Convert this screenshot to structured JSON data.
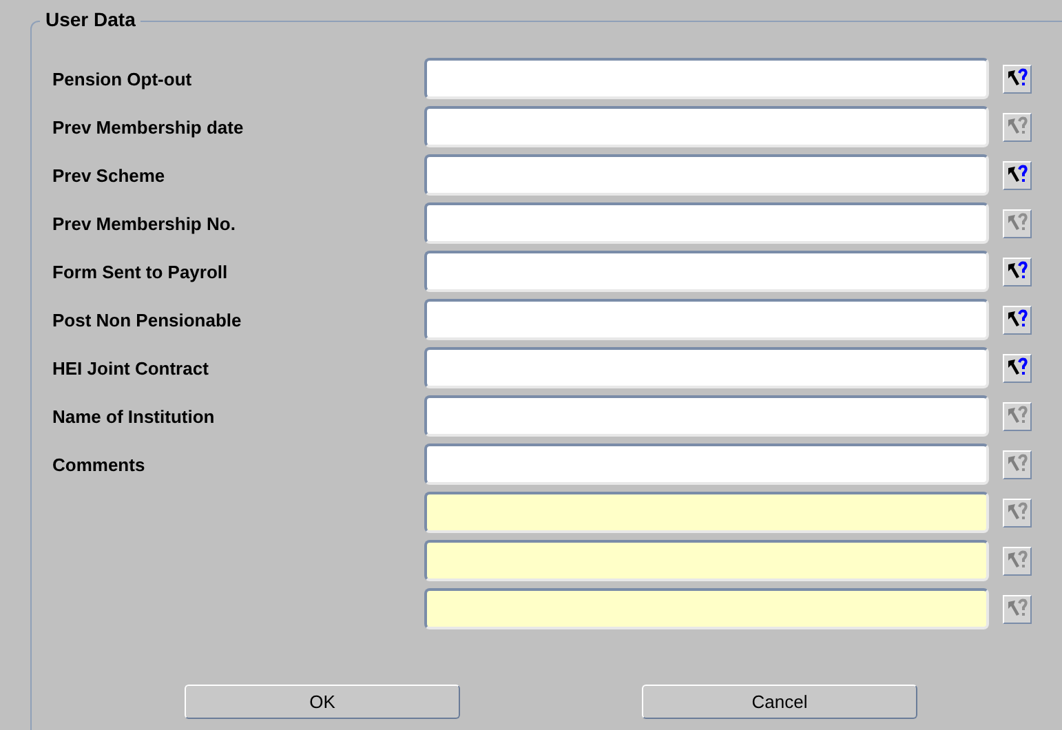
{
  "frame": {
    "title": "User Data"
  },
  "fields": [
    {
      "label": "Pension Opt-out",
      "highlighted": false,
      "lov_disabled": false
    },
    {
      "label": "Prev Membership date",
      "highlighted": false,
      "lov_disabled": true
    },
    {
      "label": "Prev Scheme",
      "highlighted": false,
      "lov_disabled": false
    },
    {
      "label": "Prev Membership No.",
      "highlighted": false,
      "lov_disabled": true
    },
    {
      "label": "Form Sent to Payroll",
      "highlighted": false,
      "lov_disabled": false
    },
    {
      "label": "Post Non Pensionable",
      "highlighted": false,
      "lov_disabled": false
    },
    {
      "label": "HEI Joint Contract",
      "highlighted": false,
      "lov_disabled": false
    },
    {
      "label": "Name of Institution",
      "highlighted": false,
      "lov_disabled": true
    },
    {
      "label": "Comments",
      "highlighted": false,
      "lov_disabled": true
    },
    {
      "highlighted": true,
      "lov_disabled": true
    },
    {
      "highlighted": true,
      "lov_disabled": true
    },
    {
      "highlighted": true,
      "lov_disabled": true
    }
  ],
  "buttons": [
    "OK",
    "Cancel"
  ]
}
